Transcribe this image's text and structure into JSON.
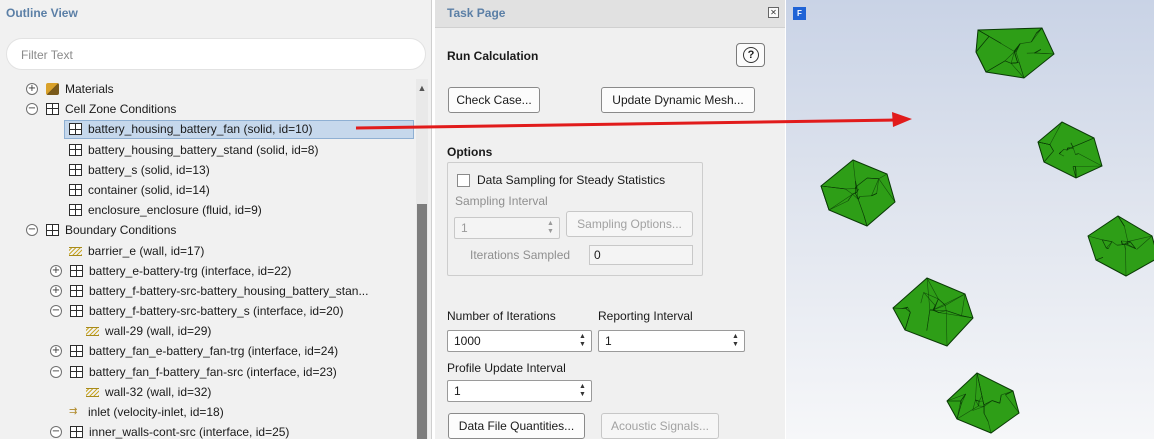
{
  "outline": {
    "title": "Outline View",
    "filter_placeholder": "Filter Text",
    "rows": [
      {
        "label": "Materials",
        "indent": 0,
        "toggle": "+",
        "icon": "materials"
      },
      {
        "label": "Cell Zone Conditions",
        "indent": 0,
        "toggle": "−",
        "icon": "grid"
      },
      {
        "label": "battery_housing_battery_fan (solid, id=10)",
        "indent": 2,
        "toggle": "",
        "icon": "grid",
        "selected": true
      },
      {
        "label": "battery_housing_battery_stand (solid, id=8)",
        "indent": 2,
        "toggle": "",
        "icon": "grid"
      },
      {
        "label": "battery_s (solid, id=13)",
        "indent": 2,
        "toggle": "",
        "icon": "grid"
      },
      {
        "label": "container (solid, id=14)",
        "indent": 2,
        "toggle": "",
        "icon": "grid"
      },
      {
        "label": "enclosure_enclosure (fluid, id=9)",
        "indent": 2,
        "toggle": "",
        "icon": "grid"
      },
      {
        "label": "Boundary Conditions",
        "indent": 0,
        "toggle": "−",
        "icon": "grid"
      },
      {
        "label": "barrier_e (wall, id=17)",
        "indent": 2,
        "toggle": "",
        "icon": "wall"
      },
      {
        "label": "battery_e-battery-trg (interface, id=22)",
        "indent": 1,
        "toggle": "+",
        "icon": "grid"
      },
      {
        "label": "battery_f-battery-src-battery_housing_battery_stan...",
        "indent": 1,
        "toggle": "+",
        "icon": "grid"
      },
      {
        "label": "battery_f-battery-src-battery_s (interface, id=20)",
        "indent": 1,
        "toggle": "−",
        "icon": "grid"
      },
      {
        "label": "wall-29 (wall, id=29)",
        "indent": 3,
        "toggle": "",
        "icon": "wall"
      },
      {
        "label": "battery_fan_e-battery_fan-trg (interface, id=24)",
        "indent": 1,
        "toggle": "+",
        "icon": "grid"
      },
      {
        "label": "battery_fan_f-battery_fan-src (interface, id=23)",
        "indent": 1,
        "toggle": "−",
        "icon": "grid"
      },
      {
        "label": "wall-32 (wall, id=32)",
        "indent": 3,
        "toggle": "",
        "icon": "wall"
      },
      {
        "label": "inlet (velocity-inlet, id=18)",
        "indent": 2,
        "toggle": "",
        "icon": "inlet"
      },
      {
        "label": "inner_walls-cont-src (interface, id=25)",
        "indent": 1,
        "toggle": "−",
        "icon": "grid"
      }
    ]
  },
  "task": {
    "title": "Task Page",
    "close_glyph": "✕",
    "section_title": "Run Calculation",
    "help_glyph": "?",
    "check_case": "Check Case...",
    "update_mesh": "Update Dynamic Mesh...",
    "options_label": "Options",
    "data_sampling_label": "Data Sampling for Steady Statistics",
    "data_sampling_checked": false,
    "sampling_interval_label": "Sampling Interval",
    "sampling_interval_value": "1",
    "sampling_options": "Sampling Options...",
    "iterations_sampled_label": "Iterations Sampled",
    "iterations_sampled_value": "0",
    "num_iterations_label": "Number of Iterations",
    "num_iterations_value": "1000",
    "reporting_interval_label": "Reporting Interval",
    "reporting_interval_value": "1",
    "profile_update_label": "Profile Update Interval",
    "profile_update_value": "1",
    "data_file_quantities": "Data File Quantities...",
    "acoustic_signals": "Acoustic Signals..."
  },
  "graphics": {
    "logo_glyph": "F",
    "mesh_color": "#2e9e17",
    "mesh_line_color": "#0a3a06"
  },
  "annotation": {
    "arrow_color": "#e11b1b"
  }
}
